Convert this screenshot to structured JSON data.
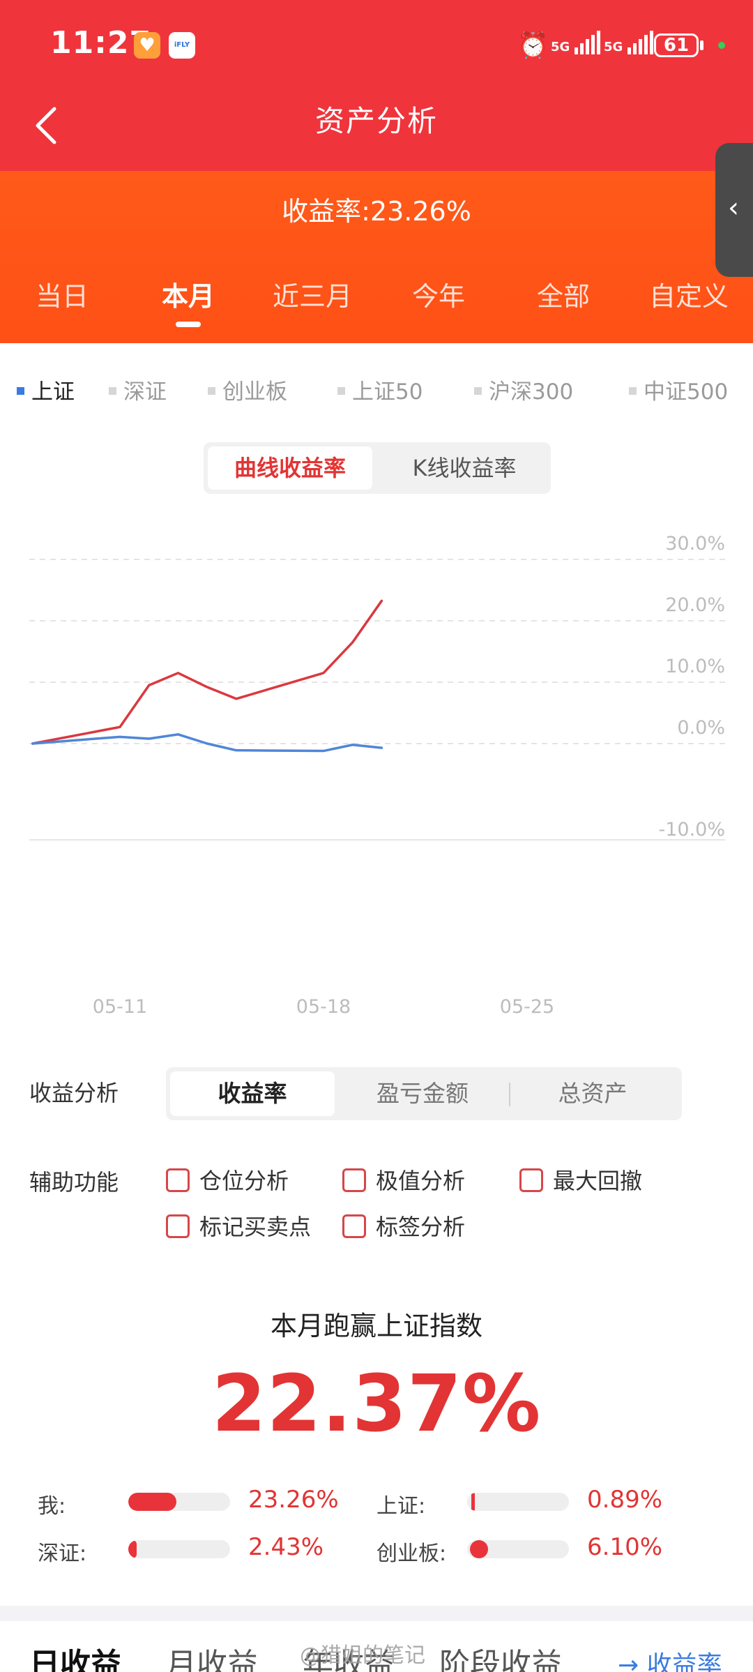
{
  "status_bar": {
    "time": "11:27",
    "app_icon_1": "heart-app-icon",
    "app_icon_2": "iFLY",
    "net1": "5G",
    "net2": "5G",
    "battery": "61"
  },
  "header": {
    "title": "资产分析",
    "return_rate": "收益率:23.26%",
    "back_icon": "chevron-left-icon",
    "side_handle_icon": "chevron-left-icon"
  },
  "period_tabs": [
    {
      "label": "当日",
      "active": false
    },
    {
      "label": "本月",
      "active": true
    },
    {
      "label": "近三月",
      "active": false
    },
    {
      "label": "今年",
      "active": false
    },
    {
      "label": "全部",
      "active": false
    },
    {
      "label": "自定义",
      "active": false
    }
  ],
  "index_legend": [
    {
      "label": "上证",
      "active": true
    },
    {
      "label": "深证",
      "active": false
    },
    {
      "label": "创业板",
      "active": false
    },
    {
      "label": "上证50",
      "active": false
    },
    {
      "label": "沪深300",
      "active": false
    },
    {
      "label": "中证500",
      "active": false
    }
  ],
  "chart_toggle": {
    "curve": "曲线收益率",
    "kline": "K线收益率"
  },
  "chart_data": {
    "type": "line",
    "ylim": [
      -10,
      30
    ],
    "yticks": [
      "30.0%",
      "20.0%",
      "10.0%",
      "0.0%",
      "-10.0%"
    ],
    "ytick_values": [
      30,
      20,
      10,
      0,
      -10
    ],
    "xticks": [
      "05-11",
      "05-18",
      "05-25"
    ],
    "xtick_days": [
      11,
      18,
      25
    ],
    "grid": true,
    "series": [
      {
        "color": "#d9393f",
        "points": [
          [
            8,
            0.0
          ],
          [
            11,
            2.7
          ],
          [
            12,
            9.5
          ],
          [
            13,
            11.5
          ],
          [
            14,
            9.2
          ],
          [
            15,
            7.3
          ],
          [
            18,
            11.5
          ],
          [
            19,
            16.5
          ],
          [
            20,
            23.26
          ]
        ]
      },
      {
        "color": "#4f86d8",
        "points": [
          [
            8,
            0.0
          ],
          [
            11,
            1.1
          ],
          [
            12,
            0.8
          ],
          [
            13,
            1.5
          ],
          [
            14,
            0.0
          ],
          [
            15,
            -1.1
          ],
          [
            18,
            -1.2
          ],
          [
            19,
            -0.2
          ],
          [
            20,
            -0.7
          ]
        ]
      }
    ]
  },
  "analysis": {
    "label": "收益分析",
    "options": [
      {
        "label": "收益率",
        "active": true
      },
      {
        "label": "盈亏金额",
        "active": false
      },
      {
        "label": "总资产",
        "active": false
      }
    ]
  },
  "aux": {
    "label": "辅助功能",
    "items": [
      "仓位分析",
      "极值分析",
      "最大回撤",
      "标记买卖点",
      "标签分析"
    ]
  },
  "beat": {
    "title": "本月跑赢上证指数",
    "value": "22.37%"
  },
  "comparison": [
    {
      "label": "我:",
      "value": "23.26%",
      "fraction": 0.47,
      "style": "bar"
    },
    {
      "label": "上证:",
      "value": "0.89%",
      "fraction": 0.03,
      "style": "line"
    },
    {
      "label": "深证:",
      "value": "2.43%",
      "fraction": 0.05,
      "style": "bar"
    },
    {
      "label": "创业板:",
      "value": "6.10%",
      "fraction": 0.12,
      "style": "dot"
    }
  ],
  "bottom_tabs": [
    {
      "label": "日收益",
      "active": true
    },
    {
      "label": "月收益",
      "active": false
    },
    {
      "label": "年收益",
      "active": false
    },
    {
      "label": "阶段收益",
      "active": false
    }
  ],
  "bottom_link": "→ 收益率",
  "watermark": "@猎姐的笔记"
}
